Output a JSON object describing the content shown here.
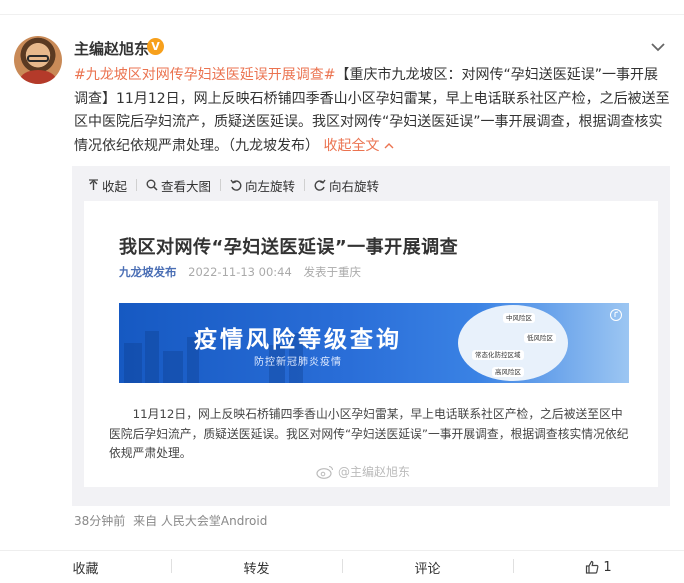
{
  "post": {
    "author": "主编赵旭东",
    "verified_badge": "V",
    "hashtag": "#九龙坡区对网传孕妇送医延误开展调查#",
    "text_line1": "【重庆市九龙坡区：对网传“孕妇送医延误”一事开展",
    "text_line2": "调查】11月12日，网上反映石桥铺四季香山小区孕妇雷某，早上电话联系社区产检，之后被送至",
    "text_line3": "区中医院后孕妇流产，质疑送医延误。我区对网传“孕妇送医延误”一事开展调查，根据调查核实",
    "text_line4": "情况依纪依规严肃处理。（九龙坡发布）",
    "collapse_label": "收起全文",
    "timestamp": "38分钟前",
    "source": "来自 人民大会堂Android"
  },
  "toolbar": {
    "collapse": "收起",
    "view_large": "查看大图",
    "rotate_left": "向左旋转",
    "rotate_right": "向右旋转"
  },
  "article": {
    "title": "我区对网传“孕妇送医延误”一事开展调查",
    "source": "九龙坡发布",
    "date": "2022-11-13 00:44",
    "location": "发表于重庆",
    "banner_title": "疫情风险等级查询",
    "banner_subtitle": "防控新冠肺炎疫情",
    "banner_pills": [
      "中风险区",
      "低风险区",
      "常态化防控区域",
      "高风险区"
    ],
    "body": "11月12日，网上反映石桥铺四季香山小区孕妇雷某，早上电话联系社区产检，之后被送至区中医院后孕妇流产，质疑送医延误。我区对网传“孕妇送医延误”一事开展调查，根据调查核实情况依纪依规严肃处理。",
    "watermark": "@主编赵旭东"
  },
  "actions": {
    "favorite": "收藏",
    "repost": "转发",
    "comment": "评论",
    "like_count": "1"
  },
  "colors": {
    "link": "#eb7350",
    "badge": "#f7a01c",
    "banner": "#1659c2"
  }
}
